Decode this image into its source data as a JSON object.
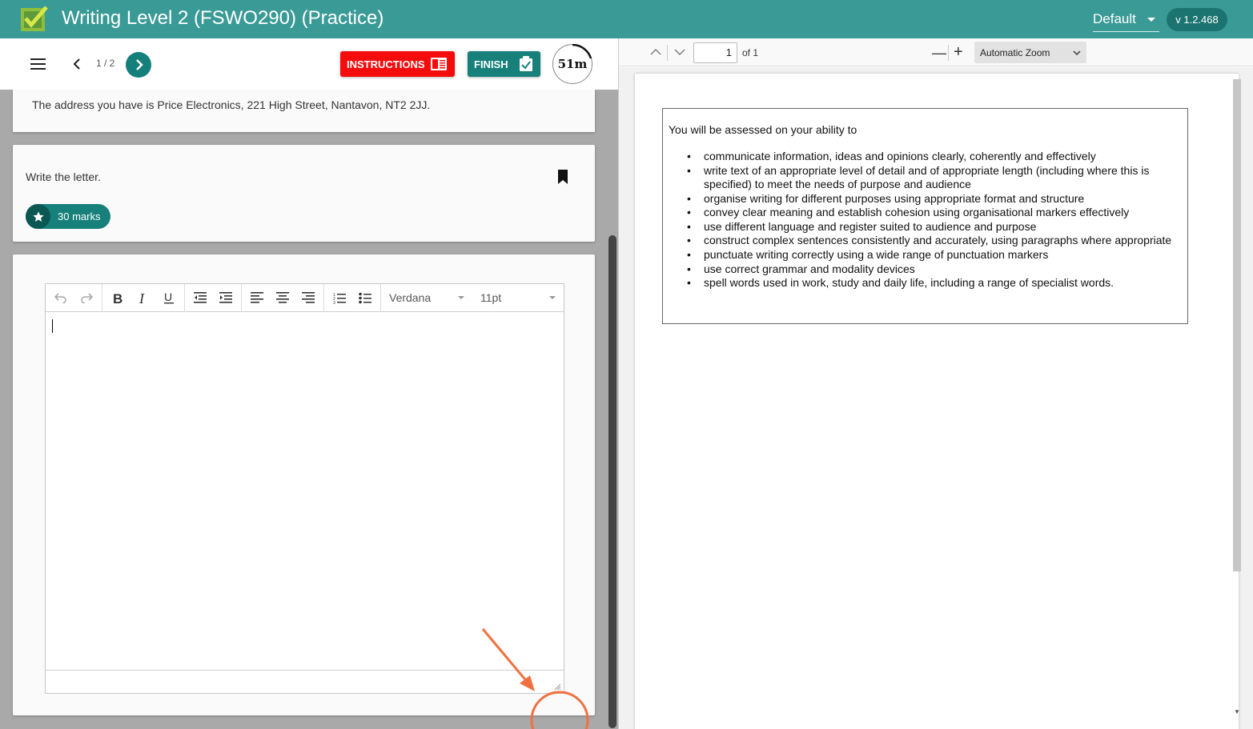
{
  "header": {
    "title": "Writing Level 2 (FSWO290) (Practice)",
    "theme": "Default",
    "version": "v 1.2.468",
    "brand_color": "#3a9a96"
  },
  "nav": {
    "page_count": "1 / 2",
    "instructions_label": "INSTRUCTIONS",
    "finish_label": "FINISH",
    "timer": "51m"
  },
  "question": {
    "address_text": "The address you have is Price Electronics, 221 High Street, Nantavon, NT2 2JJ.",
    "task_text": "Write the letter.",
    "marks": "30 marks"
  },
  "editor": {
    "font": "Verdana",
    "size": "11pt",
    "toolbar_icons": [
      "undo-icon",
      "redo-icon",
      "bold-icon",
      "italic-icon",
      "underline-icon",
      "outdent-icon",
      "indent-icon",
      "align-left-icon",
      "align-center-icon",
      "align-right-icon",
      "numbered-list-icon",
      "bullet-list-icon"
    ]
  },
  "pdf": {
    "page_value": "1",
    "page_of": "of 1",
    "zoom": "Automatic Zoom",
    "intro": "You will be assessed on your ability to",
    "items": [
      "communicate information, ideas and opinions clearly, coherently and effectively",
      "write text of an appropriate level of detail and of appropriate length (including where this is specified) to meet the needs of purpose and audience",
      "organise writing for different purposes using appropriate format and structure",
      "convey clear meaning and establish cohesion using organisational markers effectively",
      "use different language and register suited to audience and purpose",
      "construct complex sentences consistently and accurately, using paragraphs where appropriate",
      "punctuate writing correctly using a wide range of punctuation markers",
      "use correct grammar and modality devices",
      "spell words used in work, study and daily life, including a range of specialist words."
    ]
  }
}
